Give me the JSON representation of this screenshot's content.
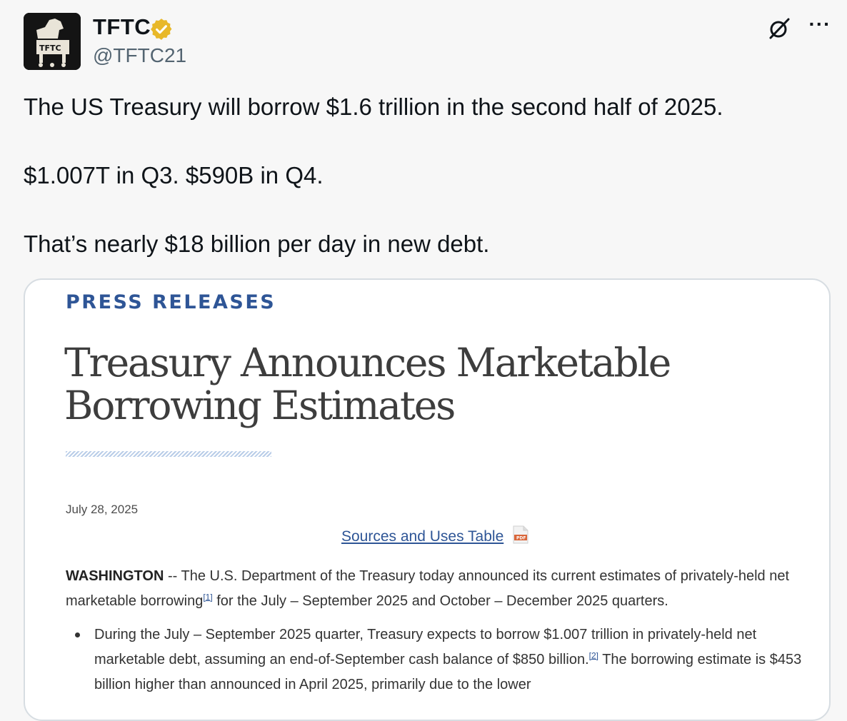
{
  "author": {
    "display_name": "TFTC",
    "handle": "@TFTC21",
    "avatar_label": "TFTC",
    "verified_badge_color": "#e8b829"
  },
  "icons": {
    "grok": "grok-icon",
    "more": "more-icon",
    "more_glyph": "···"
  },
  "tweet": {
    "line1": "The US Treasury will borrow $1.6 trillion in the second half of 2025.",
    "line2": "$1.007T in Q3. $590B in Q4.",
    "line3": "That’s nearly $18 billion per day in new debt."
  },
  "card": {
    "label": "PRESS RELEASES",
    "headline": "Treasury Announces Marketable Borrowing Estimates",
    "date": "July 28, 2025",
    "sources_link": "Sources and Uses Table",
    "pdf_label": "PDF",
    "para_lead": "WASHINGTON",
    "para_text1": " -- The U.S. Department of the Treasury today announced its current estimates of privately-held net marketable borrowing",
    "footnote1": "[1]",
    "para_text2": " for the July – September 2025 and October – December 2025 quarters.",
    "bullet_text1": "During the July – September 2025 quarter, Treasury expects to borrow $1.007 trillion in privately-held net marketable debt, assuming an end-of-September cash balance of $850 billion.",
    "footnote2": "[2]",
    "bullet_text2": "  The borrowing estimate is $453 billion higher than announced in April 2025, primarily due to the lower"
  }
}
